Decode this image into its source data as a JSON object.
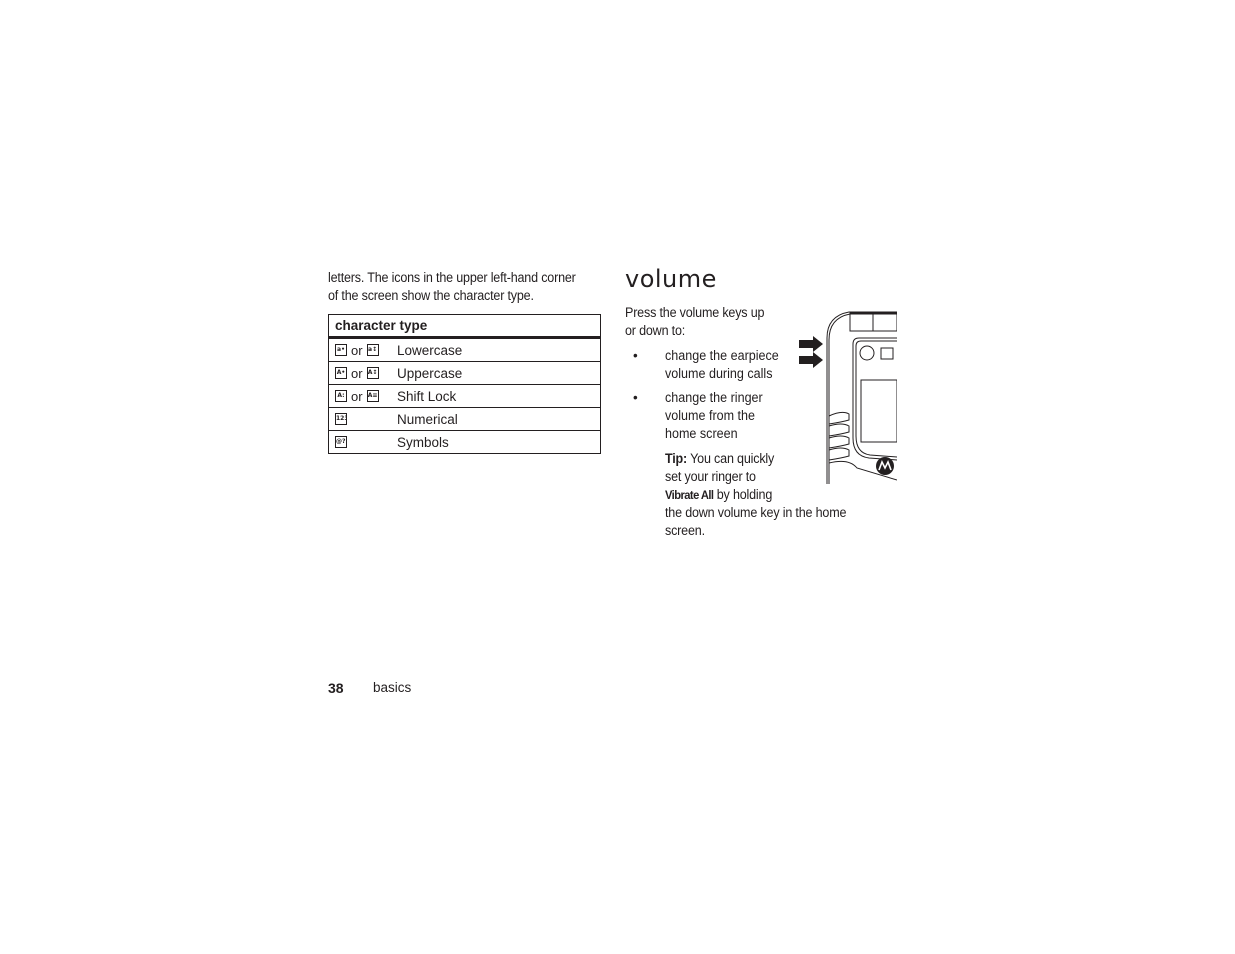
{
  "left_column": {
    "intro_text_line1": "letters. The icons in the upper left-hand corner",
    "intro_text_line2": "of the screen show the character type.",
    "table": {
      "header": "character type",
      "or_label": "or",
      "rows": [
        {
          "icons": [
            "a•",
            "a↕"
          ],
          "label": "Lowercase"
        },
        {
          "icons": [
            "A•",
            "A↕"
          ],
          "label": "Uppercase"
        },
        {
          "icons": [
            "A:",
            "A≡"
          ],
          "label": "Shift Lock"
        },
        {
          "icons": [
            "123"
          ],
          "label": "Numerical"
        },
        {
          "icons": [
            "@?!"
          ],
          "label": "Symbols"
        }
      ]
    }
  },
  "right_column": {
    "title": "volume",
    "lead_line1": "Press the volume keys up",
    "lead_line2": "or down to:",
    "bullets": [
      {
        "line1": "change the earpiece",
        "line2": "volume during calls"
      },
      {
        "line1": "change the ringer",
        "line2": "volume from the",
        "line3": "home screen"
      }
    ],
    "bullet_glyph": "•",
    "tip": {
      "label": "Tip:",
      "line1_rest": " You can quickly",
      "line2": "set your ringer to",
      "setting_name": "Vibrate All",
      "line3_rest": " by holding",
      "line4": "the down volume key in the home",
      "line5": "screen."
    },
    "illustration": "phone-side-volume-keys"
  },
  "footer": {
    "page_number": "38",
    "section": "basics"
  }
}
